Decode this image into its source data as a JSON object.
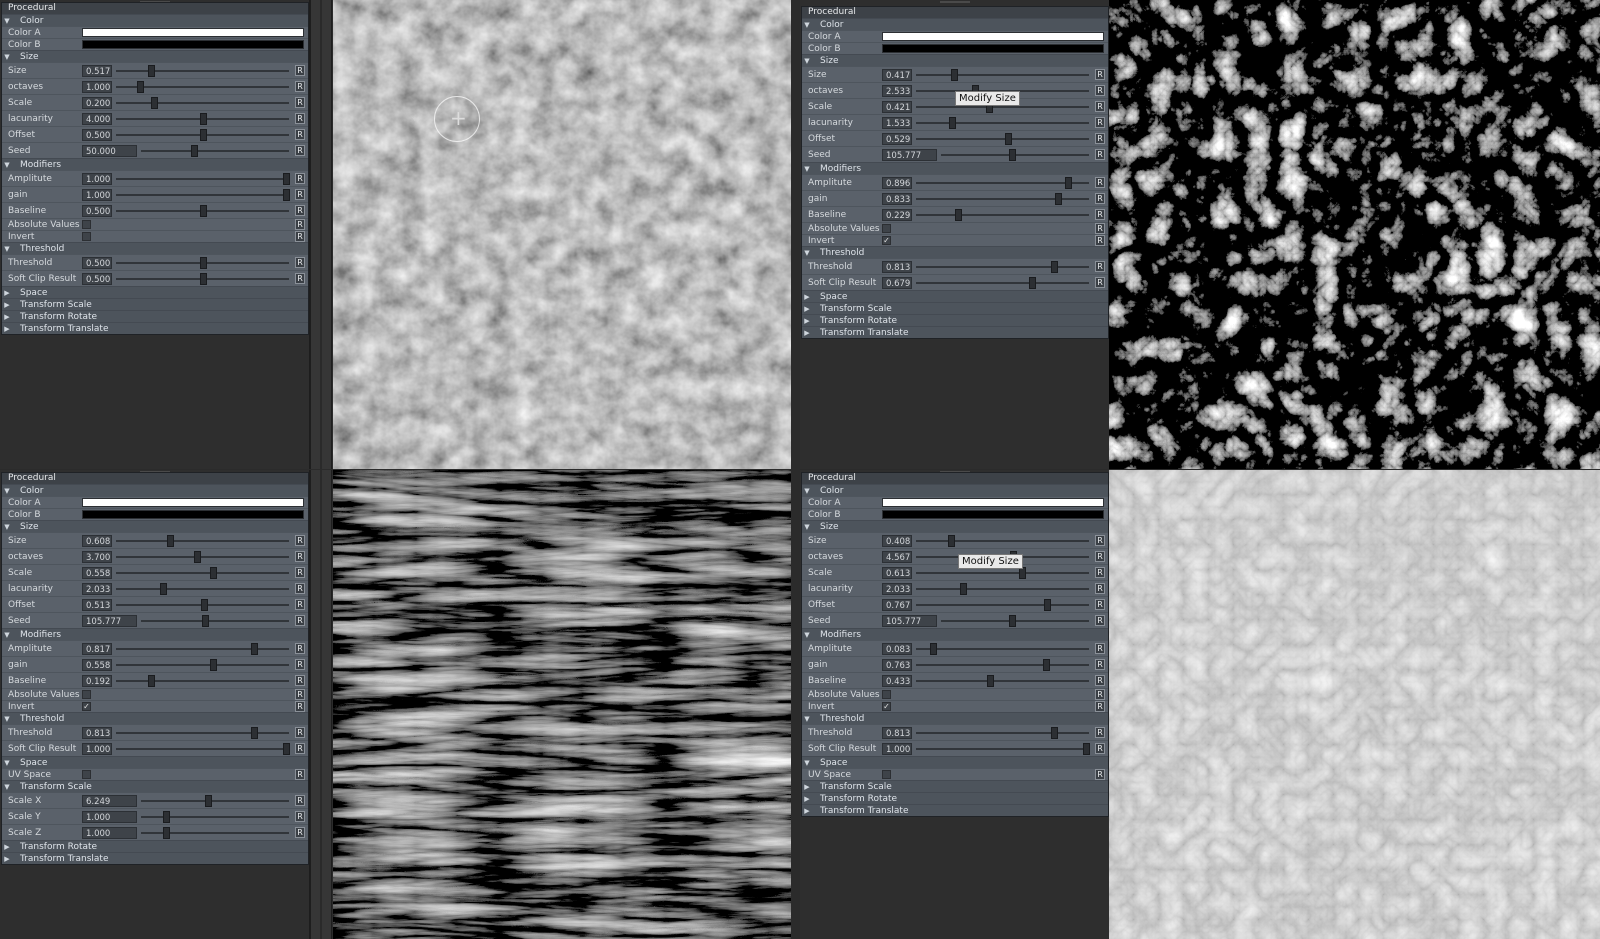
{
  "panels": [
    {
      "title": "Procedural",
      "color": {
        "label": "Color",
        "a": "Color A",
        "b": "Color B",
        "a_color": "#ffffff",
        "b_color": "#000000"
      },
      "size": {
        "label": "Size",
        "params": [
          {
            "label": "Size",
            "value": "0.517",
            "pct": 0.2
          },
          {
            "label": "octaves",
            "value": "1.000",
            "pct": 0.14
          },
          {
            "label": "Scale",
            "value": "0.200",
            "pct": 0.22
          },
          {
            "label": "lacunarity",
            "value": "4.000",
            "pct": 0.5
          },
          {
            "label": "Offset",
            "value": "0.500",
            "pct": 0.5
          },
          {
            "label": "Seed",
            "value": "50.000",
            "pct": 0.36
          }
        ]
      },
      "modifiers": {
        "label": "Modifiers",
        "params": [
          {
            "label": "Amplitute",
            "value": "1.000",
            "pct": 0.98
          },
          {
            "label": "gain",
            "value": "1.000",
            "pct": 0.98
          },
          {
            "label": "Baseline",
            "value": "0.500",
            "pct": 0.5
          }
        ],
        "abs": "Absolute Values",
        "abs_checked": "",
        "invert": "Invert",
        "invert_checked": ""
      },
      "threshold": {
        "label": "Threshold",
        "params": [
          {
            "label": "Threshold",
            "value": "0.500",
            "pct": 0.5
          },
          {
            "label": "Soft Clip Result",
            "value": "0.500",
            "pct": 0.5
          }
        ]
      },
      "space": "Space",
      "ts": "Transform Scale",
      "tr": "Transform Rotate",
      "tt": "Transform Translate",
      "rlabel": "R"
    },
    {
      "title": "Procedural",
      "color": {
        "label": "Color",
        "a": "Color A",
        "b": "Color B",
        "a_color": "#ffffff",
        "b_color": "#000000"
      },
      "size": {
        "label": "Size",
        "params": [
          {
            "label": "Size",
            "value": "0.417",
            "pct": 0.22
          },
          {
            "label": "octaves",
            "value": "2.533",
            "pct": 0.34
          },
          {
            "label": "Scale",
            "value": "0.421",
            "pct": 0.42
          },
          {
            "label": "lacunarity",
            "value": "1.533",
            "pct": 0.21
          },
          {
            "label": "Offset",
            "value": "0.529",
            "pct": 0.53
          },
          {
            "label": "Seed",
            "value": "105.777",
            "pct": 0.48
          }
        ]
      },
      "modifiers": {
        "label": "Modifiers",
        "params": [
          {
            "label": "Amplitute",
            "value": "0.896",
            "pct": 0.88
          },
          {
            "label": "gain",
            "value": "0.833",
            "pct": 0.82
          },
          {
            "label": "Baseline",
            "value": "0.229",
            "pct": 0.24
          }
        ],
        "abs": "Absolute Values",
        "abs_checked": "",
        "invert": "Invert",
        "invert_checked": "✓"
      },
      "threshold": {
        "label": "Threshold",
        "params": [
          {
            "label": "Threshold",
            "value": "0.813",
            "pct": 0.8
          },
          {
            "label": "Soft Clip Result",
            "value": "0.679",
            "pct": 0.67
          }
        ]
      },
      "space": "Space",
      "ts": "Transform Scale",
      "tr": "Transform Rotate",
      "tt": "Transform Translate",
      "rlabel": "R",
      "tooltip": "Modify Size"
    },
    {
      "title": "Procedural",
      "color": {
        "label": "Color",
        "a": "Color A",
        "b": "Color B",
        "a_color": "#ffffff",
        "b_color": "#000000"
      },
      "size": {
        "label": "Size",
        "params": [
          {
            "label": "Size",
            "value": "0.608",
            "pct": 0.31
          },
          {
            "label": "octaves",
            "value": "3.700",
            "pct": 0.47
          },
          {
            "label": "Scale",
            "value": "0.558",
            "pct": 0.56
          },
          {
            "label": "lacunarity",
            "value": "2.033",
            "pct": 0.27
          },
          {
            "label": "Offset",
            "value": "0.513",
            "pct": 0.51
          },
          {
            "label": "Seed",
            "value": "105.777",
            "pct": 0.43
          }
        ]
      },
      "modifiers": {
        "label": "Modifiers",
        "params": [
          {
            "label": "Amplitute",
            "value": "0.817",
            "pct": 0.8
          },
          {
            "label": "gain",
            "value": "0.558",
            "pct": 0.56
          },
          {
            "label": "Baseline",
            "value": "0.192",
            "pct": 0.2
          }
        ],
        "abs": "Absolute Values",
        "abs_checked": "",
        "invert": "Invert",
        "invert_checked": "✓"
      },
      "threshold": {
        "label": "Threshold",
        "params": [
          {
            "label": "Threshold",
            "value": "0.813",
            "pct": 0.8
          },
          {
            "label": "Soft Clip Result",
            "value": "1.000",
            "pct": 0.98
          }
        ]
      },
      "space": "Space",
      "uv": "UV Space",
      "uv_checked": "",
      "tscale": {
        "label": "Transform Scale",
        "params": [
          {
            "label": "Scale X",
            "value": "6.249",
            "pct": 0.45
          },
          {
            "label": "Scale Y",
            "value": "1.000",
            "pct": 0.17
          },
          {
            "label": "Scale Z",
            "value": "1.000",
            "pct": 0.17
          }
        ]
      },
      "tr": "Transform Rotate",
      "tt": "Transform Translate",
      "rlabel": "R"
    },
    {
      "title": "Procedural",
      "color": {
        "label": "Color",
        "a": "Color A",
        "b": "Color B",
        "a_color": "#ffffff",
        "b_color": "#000000"
      },
      "size": {
        "label": "Size",
        "params": [
          {
            "label": "Size",
            "value": "0.408",
            "pct": 0.2
          },
          {
            "label": "octaves",
            "value": "4.567",
            "pct": 0.56
          },
          {
            "label": "Scale",
            "value": "0.613",
            "pct": 0.61
          },
          {
            "label": "lacunarity",
            "value": "2.033",
            "pct": 0.27
          },
          {
            "label": "Offset",
            "value": "0.767",
            "pct": 0.76
          },
          {
            "label": "Seed",
            "value": "105.777",
            "pct": 0.48
          }
        ]
      },
      "modifiers": {
        "label": "Modifiers",
        "params": [
          {
            "label": "Amplitute",
            "value": "0.083",
            "pct": 0.1
          },
          {
            "label": "gain",
            "value": "0.763",
            "pct": 0.75
          },
          {
            "label": "Baseline",
            "value": "0.433",
            "pct": 0.43
          }
        ],
        "abs": "Absolute Values",
        "abs_checked": "",
        "invert": "Invert",
        "invert_checked": "✓"
      },
      "threshold": {
        "label": "Threshold",
        "params": [
          {
            "label": "Threshold",
            "value": "0.813",
            "pct": 0.8
          },
          {
            "label": "Soft Clip Result",
            "value": "1.000",
            "pct": 0.98
          }
        ]
      },
      "space": "Space",
      "uv": "UV Space",
      "uv_checked": "",
      "ts": "Transform Scale",
      "tr": "Transform Rotate",
      "tt": "Transform Translate",
      "rlabel": "R",
      "tooltip": "Modify Size"
    }
  ],
  "textures": [
    "cellular-noise",
    "turbulent-noise",
    "streaked-noise",
    "soft-marble-noise"
  ]
}
